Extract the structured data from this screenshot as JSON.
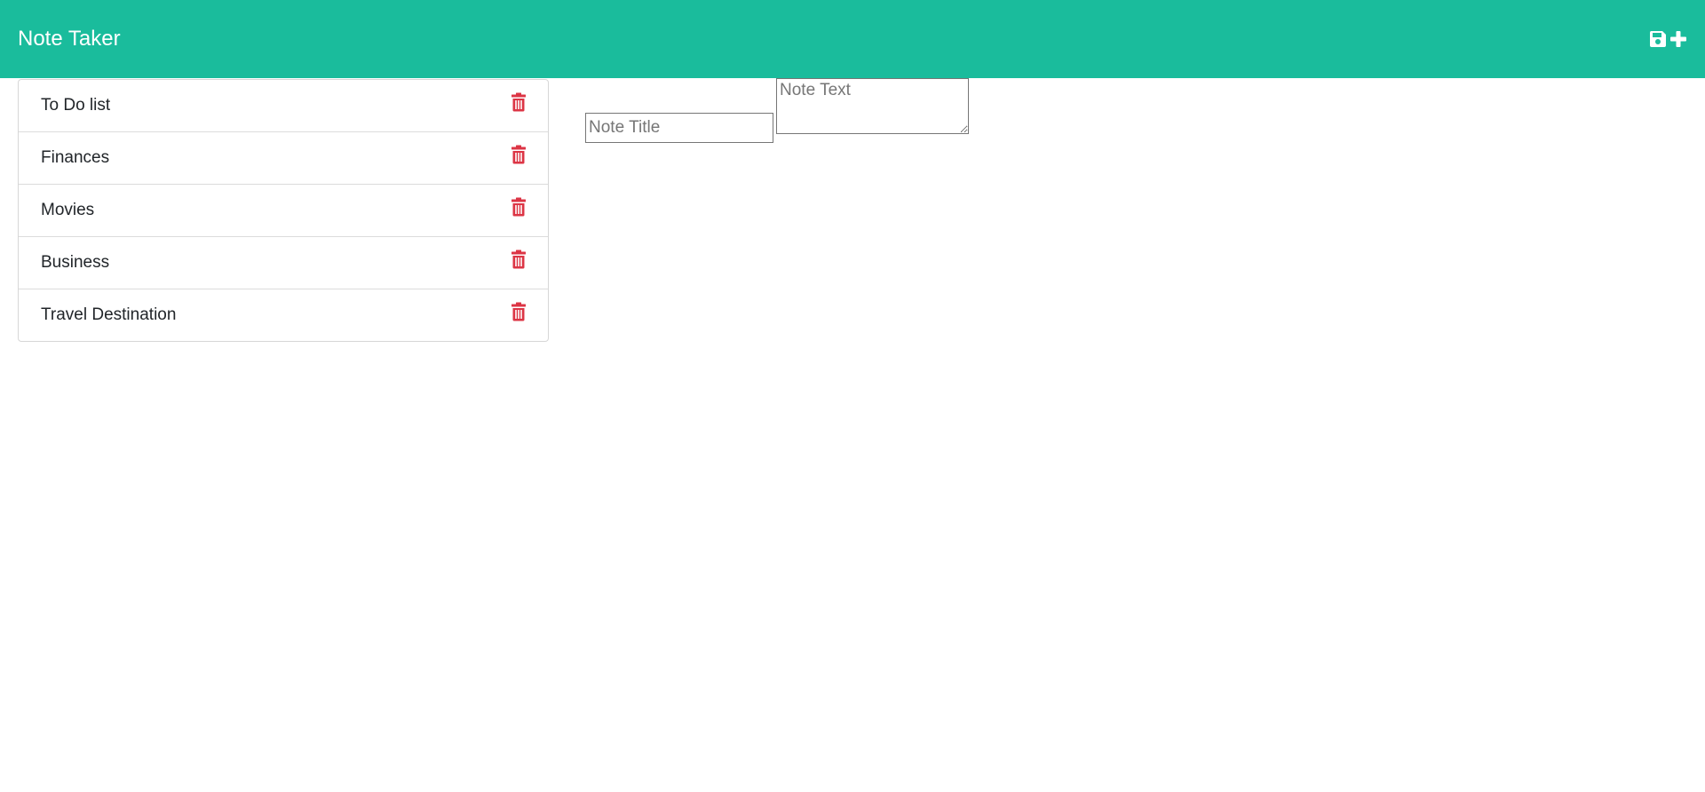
{
  "app": {
    "title": "Note Taker"
  },
  "header": {
    "actions": [
      {
        "icon": "save-icon",
        "color": "#ffffff"
      },
      {
        "icon": "plus-icon",
        "color": "#ffffff"
      }
    ],
    "background": "#1abc9c"
  },
  "notes": {
    "items": [
      {
        "label": "To Do list",
        "icon": "trash-icon"
      },
      {
        "label": "Finances",
        "icon": "trash-icon"
      },
      {
        "label": "Movies",
        "icon": "trash-icon"
      },
      {
        "label": "Business",
        "icon": "trash-icon"
      },
      {
        "label": "Travel Destination",
        "icon": "trash-icon"
      }
    ],
    "delete_color": "#dc3545"
  },
  "editor": {
    "title_placeholder": "Note Title",
    "title_value": "",
    "text_placeholder": "Note Text",
    "text_value": ""
  }
}
